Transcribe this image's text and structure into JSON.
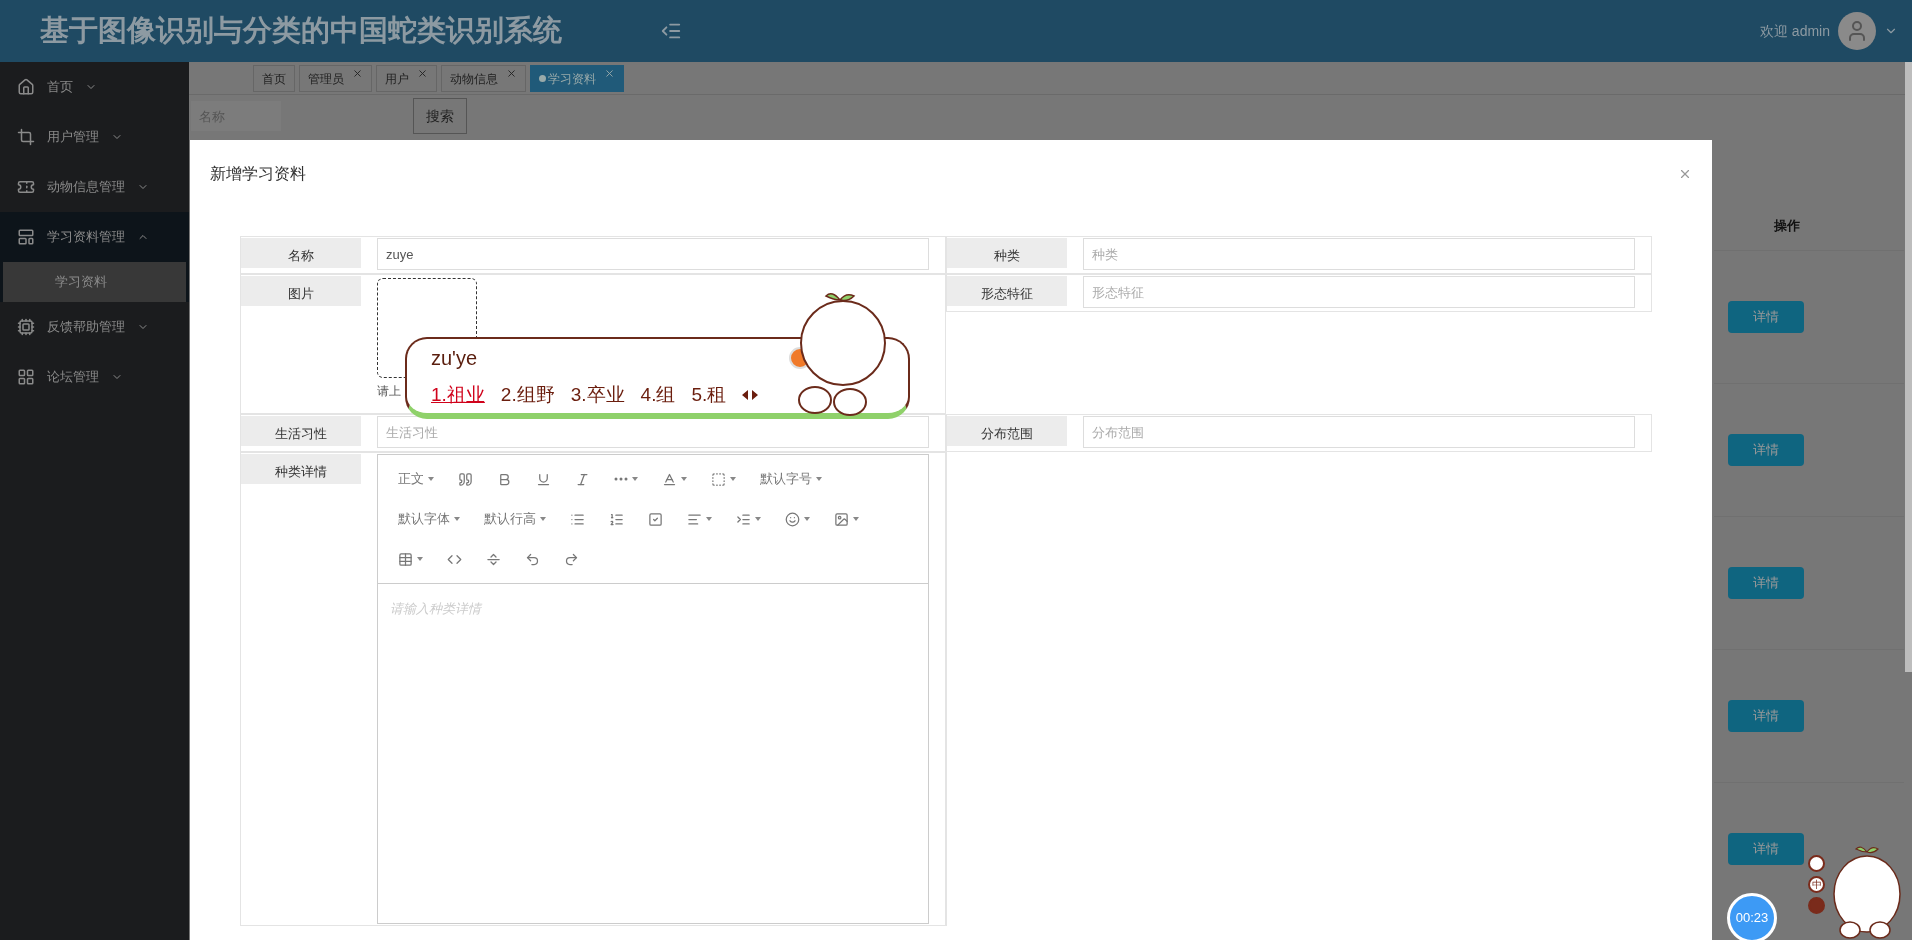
{
  "header": {
    "title": "基于图像识别与分类的中国蛇类识别系统",
    "welcome": "欢迎 admin"
  },
  "sidebar": {
    "items": [
      {
        "label": "首页",
        "expanded": false
      },
      {
        "label": "用户管理",
        "expanded": false
      },
      {
        "label": "动物信息管理",
        "expanded": false
      },
      {
        "label": "学习资料管理",
        "expanded": true,
        "children": [
          {
            "label": "学习资料",
            "selected": true
          }
        ]
      },
      {
        "label": "反馈帮助管理",
        "expanded": false
      },
      {
        "label": "论坛管理",
        "expanded": false
      }
    ]
  },
  "tabs": [
    {
      "label": "首页",
      "closable": false,
      "selected": false
    },
    {
      "label": "管理员",
      "closable": true,
      "selected": false
    },
    {
      "label": "用户",
      "closable": true,
      "selected": false
    },
    {
      "label": "动物信息",
      "closable": true,
      "selected": false
    },
    {
      "label": "学习资料",
      "closable": true,
      "selected": true
    }
  ],
  "search": {
    "placeholder": "名称",
    "button": "搜索"
  },
  "table": {
    "column": "操作",
    "rows": [
      "详情",
      "详情",
      "详情",
      "详情",
      "详情"
    ]
  },
  "modal": {
    "title": "新增学习资料",
    "fields": [
      {
        "label": "名称",
        "kind": "text",
        "value": "zuye"
      },
      {
        "label": "种类",
        "kind": "text",
        "placeholder": "种类"
      },
      {
        "label": "图片",
        "kind": "upload",
        "hint": "请上"
      },
      {
        "label": "形态特征",
        "kind": "text",
        "placeholder": "形态特征"
      },
      {
        "label": "生活习性",
        "kind": "text",
        "placeholder": "生活习性"
      },
      {
        "label": "分布范围",
        "kind": "text",
        "placeholder": "分布范围"
      },
      {
        "label": "种类详情",
        "kind": "editor",
        "placeholder": "请输入种类详情"
      }
    ],
    "toolbar_dropdowns": [
      "正文",
      "默认字号",
      "默认字体",
      "默认行高"
    ]
  },
  "ime": {
    "composition": "zu'ye",
    "candidates": [
      {
        "label": "1.祖业",
        "selected": true
      },
      {
        "label": "2.组野",
        "selected": false
      },
      {
        "label": "3.卒业",
        "selected": false
      },
      {
        "label": "4.组",
        "selected": false
      },
      {
        "label": "5.租",
        "selected": false
      }
    ],
    "mode": "中",
    "timer": "00:23"
  }
}
